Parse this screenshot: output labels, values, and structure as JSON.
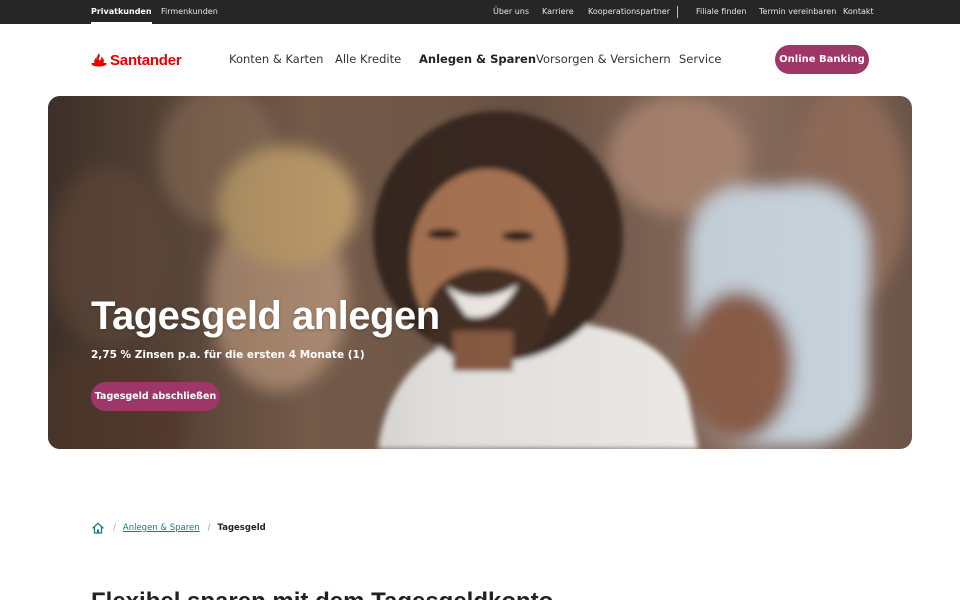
{
  "topbar": {
    "left": [
      "Privatkunden",
      "Firmenkunden"
    ],
    "right": [
      "Über uns",
      "Karriere",
      "Kooperationspartner",
      "Filiale finden",
      "Termin vereinbaren",
      "Kontakt"
    ]
  },
  "header": {
    "brand": "Santander",
    "nav": [
      "Konten & Karten",
      "Alle Kredite",
      "Anlegen & Sparen",
      "Vorsorgen & Versichern",
      "Service"
    ],
    "online_banking": "Online Banking"
  },
  "hero": {
    "title": "Tagesgeld anlegen",
    "subtitle": "2,75 % Zinsen p.a. für die ersten 4 Monate (1)",
    "cta": "Tagesgeld abschließen"
  },
  "breadcrumb": {
    "home_icon": "home-icon",
    "parent": "Anlegen & Sparen",
    "current": "Tagesgeld",
    "separator": "/"
  },
  "section": {
    "title": "Flexibel sparen mit dem Tagesgeldkonto"
  },
  "colors": {
    "brand_red": "#ec0000",
    "button": "#9e3667",
    "topbar": "#262626",
    "link": "#137e84"
  }
}
